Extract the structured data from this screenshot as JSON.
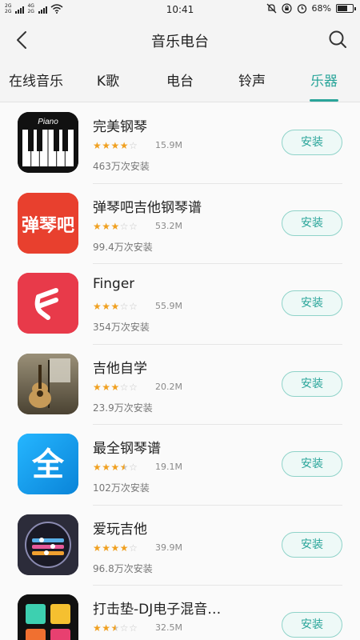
{
  "status": {
    "signal_top": "2G",
    "signal_bottom": "2G",
    "network_top": "4G",
    "network_bottom": "2G",
    "time": "10:41",
    "battery": "68%",
    "battery_level": 0.68
  },
  "header": {
    "title": "音乐电台"
  },
  "tabs": [
    {
      "label": "在线音乐",
      "active": false
    },
    {
      "label": "K歌",
      "active": false
    },
    {
      "label": "电台",
      "active": false
    },
    {
      "label": "铃声",
      "active": false
    },
    {
      "label": "乐器",
      "active": true
    }
  ],
  "apps": [
    {
      "name": "完美钢琴",
      "rating": 4,
      "size": "15.9M",
      "downloads": "463万次安装",
      "action": "安装",
      "icon": "piano-icon",
      "icon_text": "Piano"
    },
    {
      "name": "弹琴吧吉他钢琴谱",
      "rating": 3,
      "size": "53.2M",
      "downloads": "99.4万次安装",
      "action": "安装",
      "icon": "tanqinba-icon",
      "icon_text": "弹琴吧"
    },
    {
      "name": "Finger",
      "rating": 3,
      "size": "55.9M",
      "downloads": "354万次安装",
      "action": "安装",
      "icon": "finger-icon",
      "icon_text": ""
    },
    {
      "name": "吉他自学",
      "rating": 3,
      "size": "20.2M",
      "downloads": "23.9万次安装",
      "action": "安装",
      "icon": "guitar-photo-icon",
      "icon_text": ""
    },
    {
      "name": "最全钢琴谱",
      "rating": 3.5,
      "size": "19.1M",
      "downloads": "102万次安装",
      "action": "安装",
      "icon": "quan-icon",
      "icon_text": "全"
    },
    {
      "name": "爱玩吉他",
      "rating": 4,
      "size": "39.9M",
      "downloads": "96.8万次安装",
      "action": "安装",
      "icon": "guitar-dial-icon",
      "icon_text": ""
    },
    {
      "name": "打击垫-DJ电子混音…",
      "rating": 2.5,
      "size": "32.5M",
      "downloads": "",
      "action": "安装",
      "icon": "drum-pad-icon",
      "icon_text": ""
    }
  ],
  "colors": {
    "accent": "#2aa59a",
    "star": "#f0a020",
    "install_bg": "#eef9f7"
  }
}
